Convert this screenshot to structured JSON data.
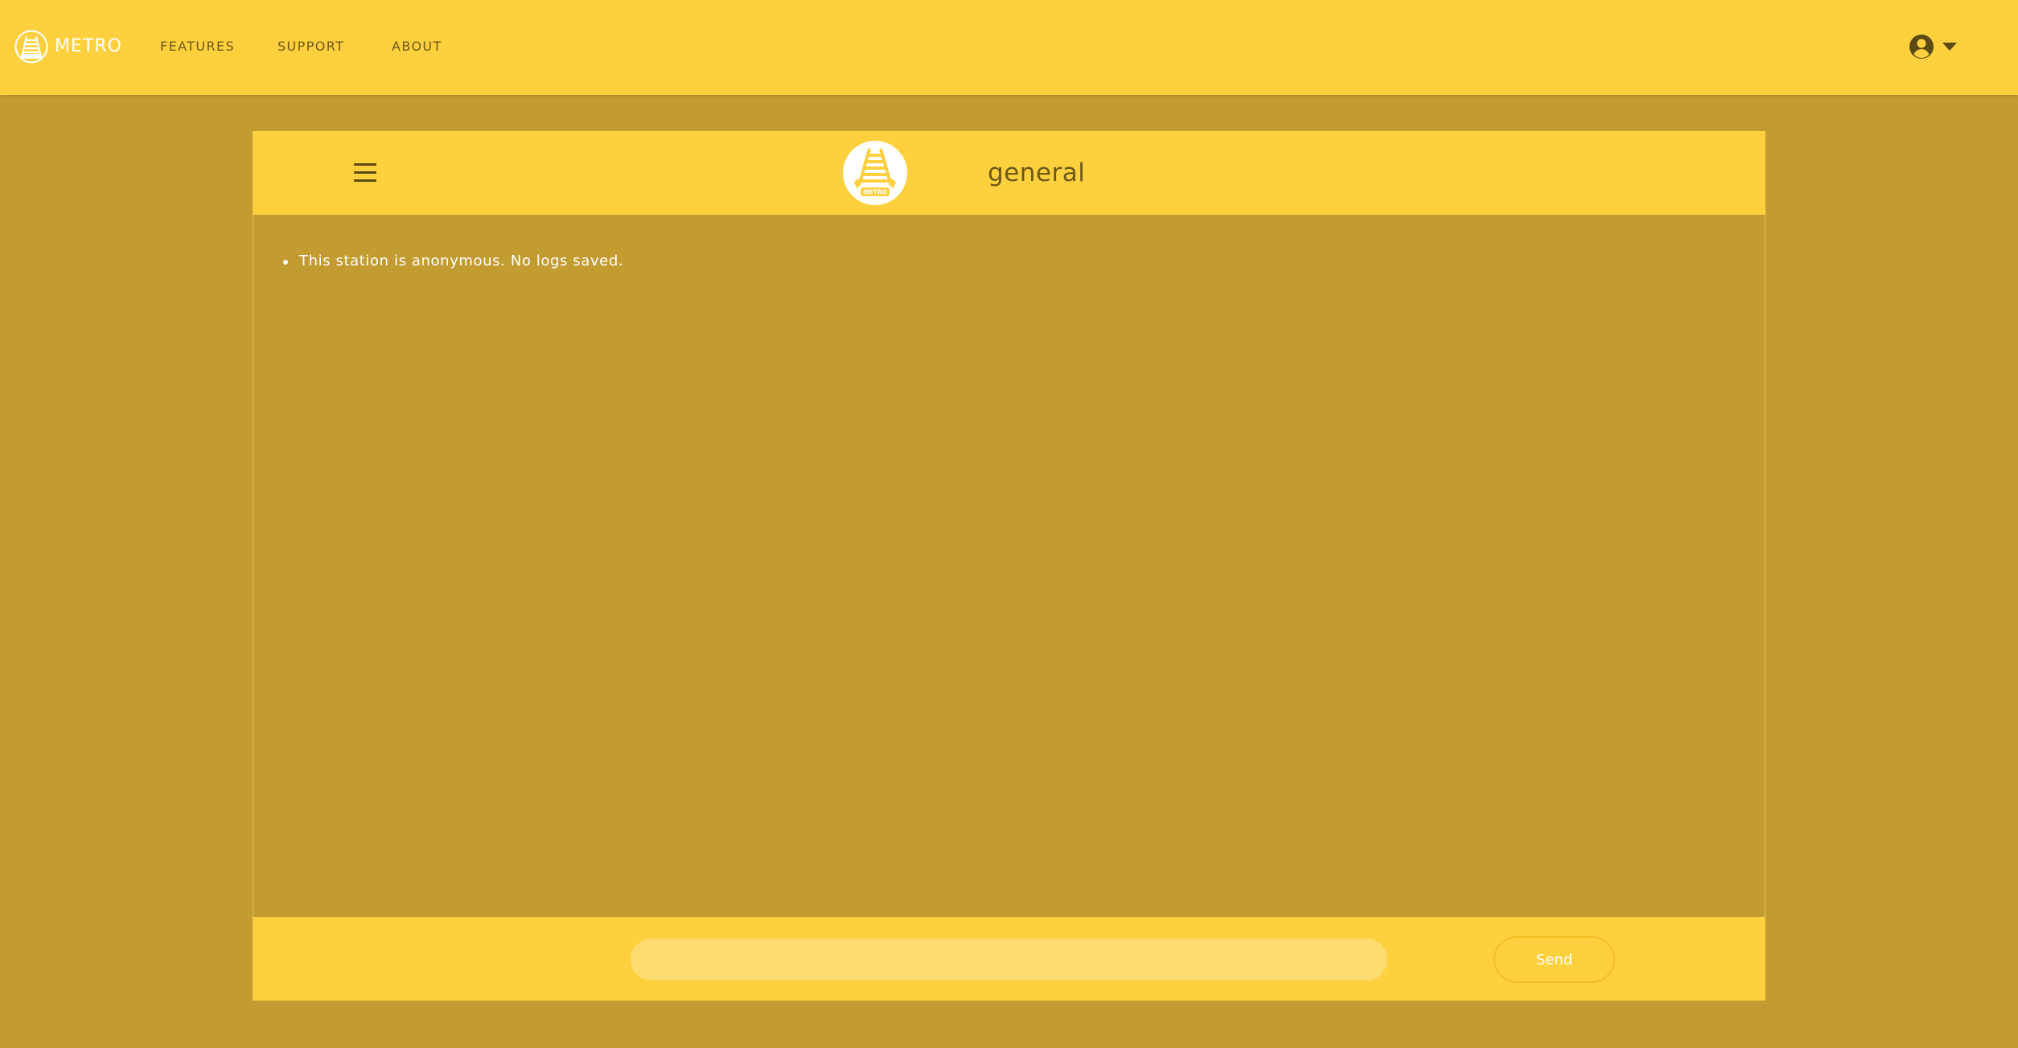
{
  "colors": {
    "navbar_bg": "#ffd03e",
    "page_bg": "#c29c31",
    "text_dark": "#6b5719",
    "text_light": "#ffffff",
    "input_bg": "#ffdc70",
    "button_border": "#f0bd22"
  },
  "navbar": {
    "brand": "METRO",
    "brand_icon": "metro-rail-logo-icon",
    "links": [
      "FEATURES",
      "SUPPORT",
      "ABOUT"
    ],
    "account_icon": "user-circle-icon",
    "account_menu_icon": "caret-down-icon"
  },
  "chat": {
    "menu_icon": "hamburger-menu-icon",
    "station_logo_text": "METRO",
    "channel": "general",
    "messages": [
      "This station is anonymous. No logs saved."
    ],
    "input": {
      "value": "",
      "placeholder": ""
    },
    "send_label": "Send"
  }
}
